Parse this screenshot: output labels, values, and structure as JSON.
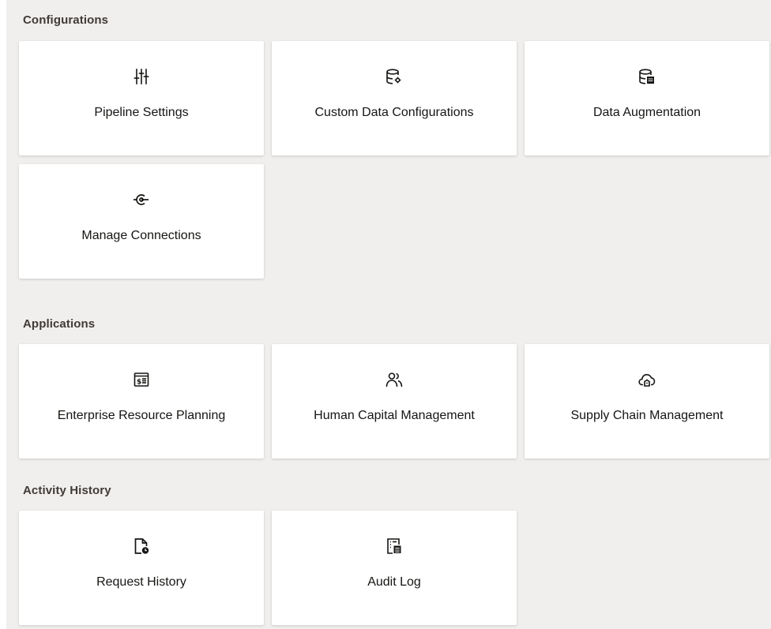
{
  "sections": {
    "configurations": {
      "title": "Configurations",
      "cards": [
        {
          "label": "Pipeline Settings",
          "icon": "sliders-icon"
        },
        {
          "label": "Custom Data Configurations",
          "icon": "database-gear-icon"
        },
        {
          "label": "Data Augmentation",
          "icon": "database-table-icon"
        },
        {
          "label": "Manage Connections",
          "icon": "connection-icon"
        }
      ]
    },
    "applications": {
      "title": "Applications",
      "cards": [
        {
          "label": "Enterprise Resource Planning",
          "icon": "finance-document-icon"
        },
        {
          "label": "Human Capital Management",
          "icon": "people-icon"
        },
        {
          "label": "Supply Chain Management",
          "icon": "cloud-building-icon"
        }
      ]
    },
    "activity_history": {
      "title": "Activity History",
      "cards": [
        {
          "label": "Request History",
          "icon": "document-clock-icon"
        },
        {
          "label": "Audit Log",
          "icon": "audit-list-icon"
        }
      ]
    }
  },
  "colors": {
    "page_background": "#f1efed",
    "card_background": "#ffffff",
    "section_title": "#3f3b38",
    "text": "#161513"
  }
}
